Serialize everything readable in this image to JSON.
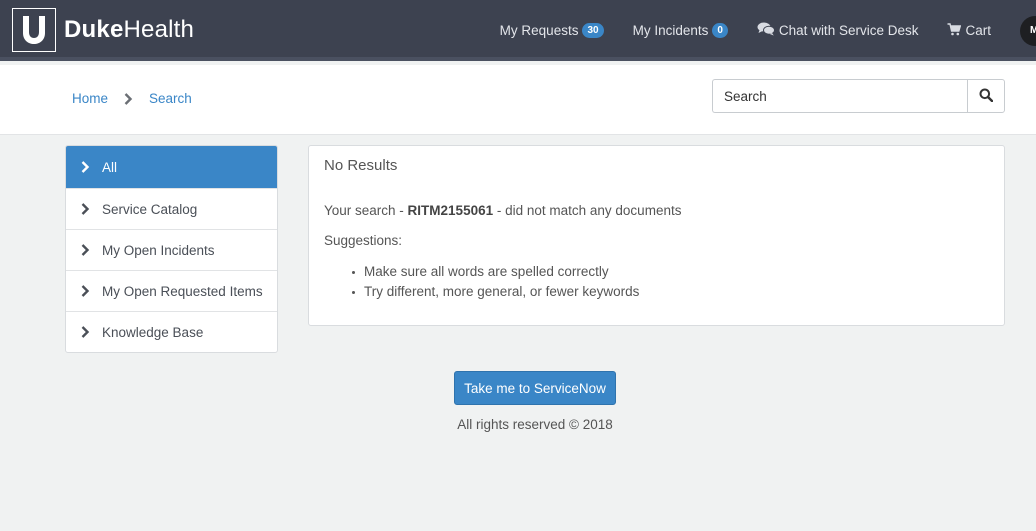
{
  "brand": {
    "name_bold": "Duke",
    "name_regular": "Health"
  },
  "nav": {
    "my_requests_label": "My Requests",
    "my_requests_count": "30",
    "my_incidents_label": "My Incidents",
    "my_incidents_count": "0",
    "chat_label": "Chat with Service Desk",
    "cart_label": "Cart",
    "avatar_initial": "M"
  },
  "breadcrumb": {
    "home": "Home",
    "current": "Search"
  },
  "search": {
    "placeholder": "Search"
  },
  "sidebar": {
    "items": [
      {
        "label": "All",
        "active": true
      },
      {
        "label": "Service Catalog",
        "active": false
      },
      {
        "label": "My Open Incidents",
        "active": false
      },
      {
        "label": "My Open Requested Items",
        "active": false
      },
      {
        "label": "Knowledge Base",
        "active": false
      }
    ]
  },
  "results": {
    "title": "No Results",
    "msg_prefix": "Your search - ",
    "query": "RITM2155061",
    "msg_suffix": " - did not match any documents",
    "suggestions_label": "Suggestions:",
    "suggestions": [
      "Make sure all words are spelled correctly",
      "Try different, more general, or fewer keywords"
    ]
  },
  "footer": {
    "cta_label": "Take me to ServiceNow",
    "copyright": "All rights reserved © 2018"
  },
  "colors": {
    "navbar": "#3d4250",
    "accent": "#3a86c7",
    "page_bg": "#f0f2f2"
  }
}
